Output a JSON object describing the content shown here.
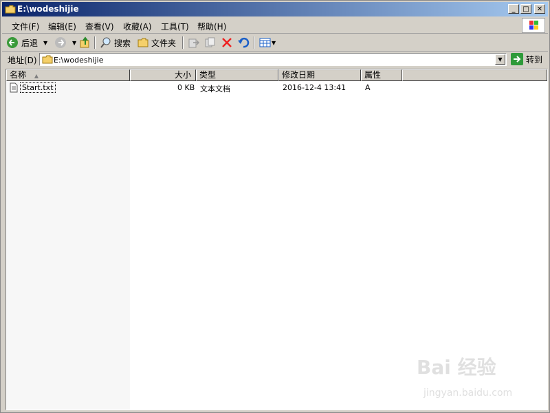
{
  "window": {
    "title": "E:\\wodeshijie"
  },
  "titlebar": {
    "min": "_",
    "max": "□",
    "close": "✕"
  },
  "menu": {
    "items": [
      "文件(F)",
      "编辑(E)",
      "查看(V)",
      "收藏(A)",
      "工具(T)",
      "帮助(H)"
    ]
  },
  "toolbar": {
    "back": "后退",
    "search": "搜索",
    "folders": "文件夹"
  },
  "address": {
    "label": "地址(D)",
    "value": "E:\\wodeshijie",
    "go": "转到"
  },
  "list": {
    "columns": [
      "名称",
      "大小",
      "类型",
      "修改日期",
      "属性"
    ],
    "rows": [
      {
        "name": "Start.txt",
        "size": "0 KB",
        "type": "文本文档",
        "modified": "2016-12-4 13:41",
        "attr": "A"
      }
    ]
  },
  "watermark": {
    "brand": "Bai  经验",
    "url": "jingyan.baidu.com"
  }
}
